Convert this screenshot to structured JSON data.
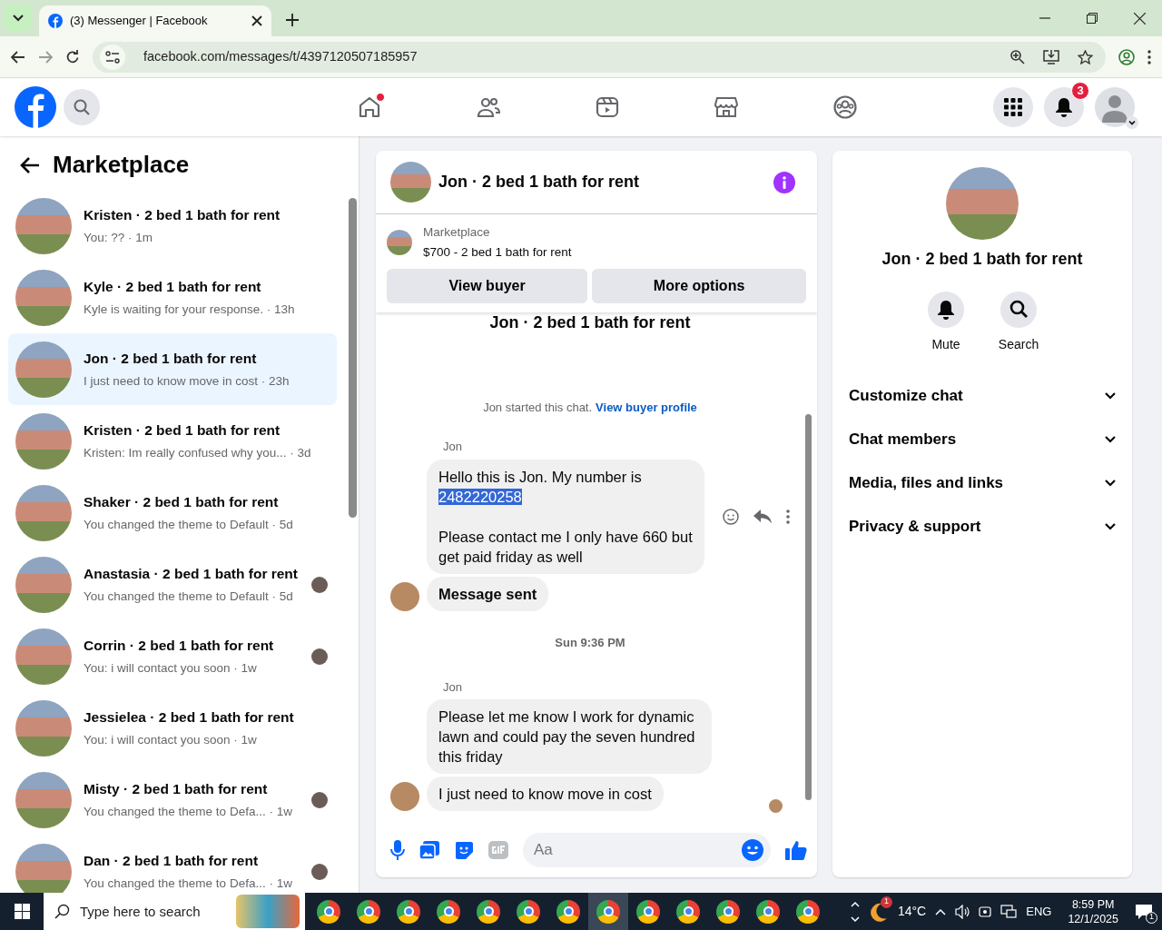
{
  "browser": {
    "tab_title": "(3) Messenger | Facebook",
    "url": "facebook.com/messages/t/4397120507185957"
  },
  "header": {
    "nav": [
      {
        "kind": "home",
        "unread": true
      },
      {
        "kind": "friends",
        "unread": false
      },
      {
        "kind": "video",
        "unread": false
      },
      {
        "kind": "marketplace",
        "unread": false
      },
      {
        "kind": "groups",
        "unread": false
      }
    ],
    "notifications_badge": "3"
  },
  "sidebar": {
    "title": "Marketplace",
    "conversations": [
      {
        "name": "Kristen · 2 bed 1 bath for rent",
        "preview": "You: ?? · 1m",
        "selected": false,
        "seen_avatar": false
      },
      {
        "name": "Kyle · 2 bed 1 bath for rent",
        "preview": "Kyle is waiting for your response. · 13h",
        "selected": false,
        "seen_avatar": false
      },
      {
        "name": "Jon · 2 bed 1 bath for rent",
        "preview": "I just need to know move in cost · 23h",
        "selected": true,
        "seen_avatar": false
      },
      {
        "name": "Kristen · 2 bed 1 bath for rent",
        "preview": "Kristen: Im really confused why you... · 3d",
        "selected": false,
        "seen_avatar": false
      },
      {
        "name": "Shaker · 2 bed 1 bath for rent",
        "preview": "You changed the theme to Default · 5d",
        "selected": false,
        "seen_avatar": false
      },
      {
        "name": "Anastasia · 2 bed 1 bath for rent",
        "preview": "You changed the theme to Default · 5d",
        "selected": false,
        "seen_avatar": true
      },
      {
        "name": "Corrin · 2 bed 1 bath for rent",
        "preview": "You: i will contact you soon · 1w",
        "selected": false,
        "seen_avatar": true
      },
      {
        "name": "Jessielea · 2 bed 1 bath for rent",
        "preview": "You: i will contact you soon · 1w",
        "selected": false,
        "seen_avatar": false
      },
      {
        "name": "Misty · 2 bed 1 bath for rent",
        "preview": "You changed the theme to Defa... · 1w",
        "selected": false,
        "seen_avatar": true
      },
      {
        "name": "Dan · 2 bed 1 bath for rent",
        "preview": "You changed the theme to Defa... · 1w",
        "selected": false,
        "seen_avatar": true
      }
    ]
  },
  "chat": {
    "title": "Jon · 2 bed 1 bath for rent",
    "listing_source": "Marketplace",
    "listing": "$700 - 2 bed 1 bath for rent",
    "buttons": [
      "View buyer",
      "More options"
    ],
    "thread_title": "Jon · 2 bed 1 bath for rent",
    "started": "Jon started this chat.",
    "profile_link": "View buyer profile",
    "messages": [
      {
        "kind": "sender",
        "text": "Jon"
      },
      {
        "kind": "bubble",
        "avatar": false,
        "actions": true,
        "bold": false,
        "paragraphs": [
          [
            {
              "text": "Hello this is Jon. My number is",
              "highlighted": false
            },
            {
              "text": "2482220258",
              "highlighted": true
            }
          ],
          [
            {
              "text": "Please contact me I only have 660 but get paid friday as well",
              "highlighted": false
            }
          ]
        ]
      },
      {
        "kind": "bubble",
        "avatar": true,
        "actions": false,
        "bold": true,
        "paragraphs": [
          [
            {
              "text": "Message sent",
              "highlighted": false
            }
          ]
        ]
      },
      {
        "kind": "timestamp",
        "text": "Sun 9:36 PM"
      },
      {
        "kind": "sender",
        "text": "Jon"
      },
      {
        "kind": "bubble",
        "avatar": false,
        "actions": false,
        "bold": false,
        "paragraphs": [
          [
            {
              "text": "Please let me know I work for dynamic lawn and could pay the seven hundred this friday",
              "highlighted": false
            }
          ]
        ]
      },
      {
        "kind": "bubble",
        "avatar": true,
        "actions": false,
        "bold": false,
        "paragraphs": [
          [
            {
              "text": "I just need to know move in cost",
              "highlighted": false
            }
          ]
        ]
      }
    ],
    "composer": {
      "placeholder": "Aa"
    }
  },
  "details": {
    "title": "Jon · 2 bed 1 bath for rent",
    "actions": [
      {
        "kind": "mute",
        "label": "Mute"
      },
      {
        "kind": "search",
        "label": "Search"
      }
    ],
    "sections": [
      {
        "label": "Customize chat",
        "expanded": false
      },
      {
        "label": "Chat members",
        "expanded": false
      },
      {
        "label": "Media, files and links",
        "expanded": false
      },
      {
        "label": "Privacy & support",
        "expanded": false
      }
    ]
  },
  "taskbar": {
    "search_placeholder": "Type here to search",
    "apps": [
      {
        "selected": false
      },
      {
        "selected": false
      },
      {
        "selected": false
      },
      {
        "selected": false
      },
      {
        "selected": false
      },
      {
        "selected": false
      },
      {
        "selected": false
      },
      {
        "selected": true
      },
      {
        "selected": false
      },
      {
        "selected": false
      },
      {
        "selected": false
      },
      {
        "selected": false
      },
      {
        "selected": false
      }
    ],
    "weather_badge": "1",
    "temperature": "14°C",
    "language": "ENG",
    "time": "8:59 PM",
    "date": "12/1/2025",
    "notification_count": "1"
  }
}
